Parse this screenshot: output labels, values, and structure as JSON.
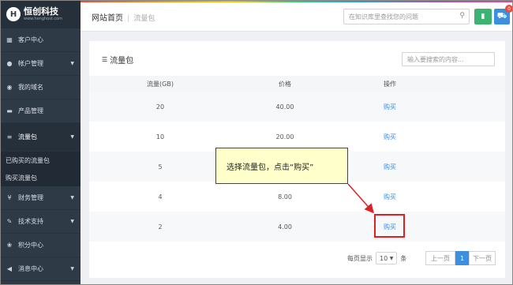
{
  "brand": {
    "name": "恒创科技",
    "url": "www.henghost.com",
    "mark": "H"
  },
  "sidebar": {
    "items": [
      {
        "label": "客户中心",
        "icon": "grid-icon",
        "glyph": "▦",
        "caret": false
      },
      {
        "label": "帐户管理",
        "icon": "user-icon",
        "glyph": "●",
        "caret": true
      },
      {
        "label": "我的域名",
        "icon": "globe-icon",
        "glyph": "◉",
        "caret": false
      },
      {
        "label": "产品管理",
        "icon": "product-icon",
        "glyph": "▬",
        "caret": false
      },
      {
        "label": "流量包",
        "icon": "list-icon",
        "glyph": "≡",
        "caret": true,
        "active": true
      },
      {
        "label": "财务管理",
        "icon": "coin-icon",
        "glyph": "¥",
        "caret": true
      },
      {
        "label": "技术支持",
        "icon": "wrench-icon",
        "glyph": "✎",
        "caret": true
      },
      {
        "label": "积分中心",
        "icon": "points-icon",
        "glyph": "❀",
        "caret": false
      },
      {
        "label": "消息中心",
        "icon": "megaphone-icon",
        "glyph": "◀",
        "caret": true
      }
    ],
    "subitems": [
      "已购买的流量包",
      "购买流量包"
    ]
  },
  "topbar": {
    "breadcrumb_home": "网站首页",
    "breadcrumb_current": "流量包",
    "search_placeholder": "在知识库里查找您的问题",
    "cart_badge": "0"
  },
  "panel": {
    "title": "流量包",
    "search_placeholder": "输入要搜索的内容...",
    "columns": [
      "流量(GB)",
      "价格",
      "操作"
    ],
    "rows": [
      {
        "traffic": "20",
        "price": "40.00",
        "action": "购买"
      },
      {
        "traffic": "10",
        "price": "20.00",
        "action": "购买"
      },
      {
        "traffic": "5",
        "price": "",
        "action": "购买"
      },
      {
        "traffic": "4",
        "price": "8.00",
        "action": "购买"
      },
      {
        "traffic": "2",
        "price": "4.00",
        "action": "购买"
      }
    ],
    "pagination": {
      "per_page_label": "每页显示",
      "per_page_value": "10",
      "per_page_unit": "条",
      "prev": "上一页",
      "current": "1",
      "next": "下一页"
    }
  },
  "annotation": {
    "text": "选择流量包，点击“购买”"
  },
  "colors": {
    "sidebar_bg": "#2f3a47",
    "accent": "#3a8fe0",
    "callout_bg": "#ffffcc",
    "highlight": "#e02020"
  }
}
